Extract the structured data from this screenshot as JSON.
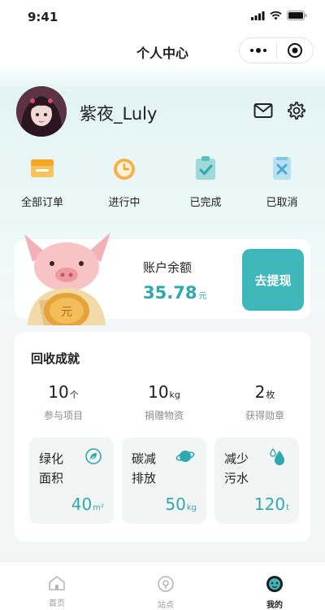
{
  "status_bar": {
    "time": "9:41"
  },
  "nav": {
    "title": "个人中心"
  },
  "profile": {
    "username": "紫夜_Luly"
  },
  "orders": [
    {
      "label": "全部订单",
      "icon": "all-orders-icon"
    },
    {
      "label": "进行中",
      "icon": "in-progress-icon"
    },
    {
      "label": "已完成",
      "icon": "completed-icon"
    },
    {
      "label": "已取消",
      "icon": "cancelled-icon"
    }
  ],
  "balance": {
    "label": "账户余额",
    "value": "35.78",
    "unit": "元",
    "withdraw_label": "去提现"
  },
  "achievements": {
    "title": "回收成就",
    "stats": [
      {
        "value": "10",
        "unit": "个",
        "caption": "参与项目"
      },
      {
        "value": "10",
        "unit": "kg",
        "caption": "捐赠物资"
      },
      {
        "value": "2",
        "unit": "枚",
        "caption": "获得勋章"
      }
    ],
    "eco": [
      {
        "title": "绿化面积",
        "value": "40",
        "unit": "m²",
        "icon": "leaf-icon"
      },
      {
        "title": "碳减排放",
        "value": "50",
        "unit": "kg",
        "icon": "planet-icon"
      },
      {
        "title": "减少污水",
        "value": "120",
        "unit": "t",
        "icon": "water-drop-icon"
      }
    ]
  },
  "tabbar": [
    {
      "label": "首页",
      "icon": "home-icon",
      "active": false
    },
    {
      "label": "站点",
      "icon": "location-icon",
      "active": false
    },
    {
      "label": "我的",
      "icon": "profile-icon",
      "active": true
    }
  ],
  "colors": {
    "accent": "#3fb8bb",
    "accent_text": "#2da9ae",
    "orange": "#f5a623",
    "background_tint": "#e3f4f4"
  }
}
